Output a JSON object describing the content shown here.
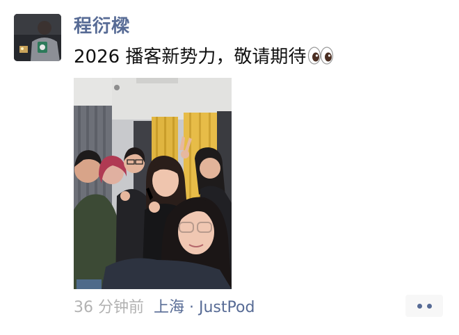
{
  "post": {
    "author": "程衍樑",
    "text": "2026 播客新势力，敬请期待",
    "emoji": "eyes-emoji",
    "time_ago": "36 分钟前",
    "location": "上海 · JustPod"
  },
  "icons": {
    "more": "more-dots-icon",
    "avatar": "avatar-icon"
  },
  "colors": {
    "name_link": "#576b95",
    "meta_gray": "#b2b2b2",
    "text": "#111111",
    "button_bg": "#f7f7f7"
  }
}
